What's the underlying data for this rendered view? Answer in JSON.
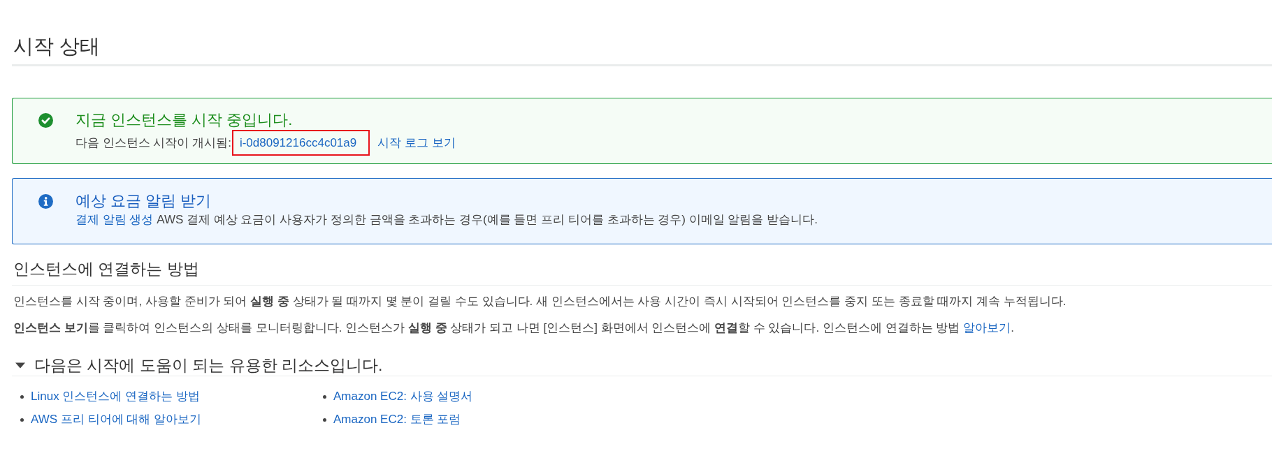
{
  "page": {
    "title": "시작 상태"
  },
  "alerts": [
    {
      "kind": "success",
      "title": "지금 인스턴스를 시작 중입니다.",
      "label": "다음 인스턴스 시작이 개시됨:",
      "instance_link": {
        "text": "i-0d8091216cc4c01a9",
        "highlighted": true
      },
      "log_link": "시작 로그 보기"
    },
    {
      "kind": "info",
      "title": "예상 요금 알림 받기",
      "link": "결제 알림 생성",
      "text": "AWS 결제 예상 요금이 사용자가 정의한 금액을 초과하는 경우(예를 들면 프리 티어를 초과하는 경우) 이메일 알림을 받습니다."
    }
  ],
  "connect": {
    "title": "인스턴스에 연결하는 방법",
    "paragraphs": [
      {
        "text": "인스턴스를 시작 중이며, 사용할 준비가 되어 **실행 중** 상태가 될 때까지 몇 분이 걸릴 수도 있습니다. 새 인스턴스에서는 사용 시간이 즉시 시작되어 인스턴스를 중지 또는 종료할 때까지 계속 누적됩니다."
      },
      {
        "text": "**인스턴스 보기**를 클릭하여 인스턴스의 상태를 모니터링합니다. 인스턴스가 **실행 중** 상태가 되고 나면 [인스턴스] 화면에서 인스턴스에 **연결**할 수 있습니다. 인스턴스에 연결하는 방법",
        "link": "알아보기",
        "end": "."
      }
    ]
  },
  "resources": {
    "title": "다음은 시작에 도움이 되는 유용한 리소스입니다.",
    "expanded": true,
    "columns": [
      {
        "links": [
          "Linux 인스턴스에 연결하는 방법",
          "AWS 프리 티어에 대해 알아보기"
        ]
      },
      {
        "links": [
          "Amazon EC2: 사용 설명서",
          "Amazon EC2: 토론 포럼"
        ]
      }
    ]
  }
}
